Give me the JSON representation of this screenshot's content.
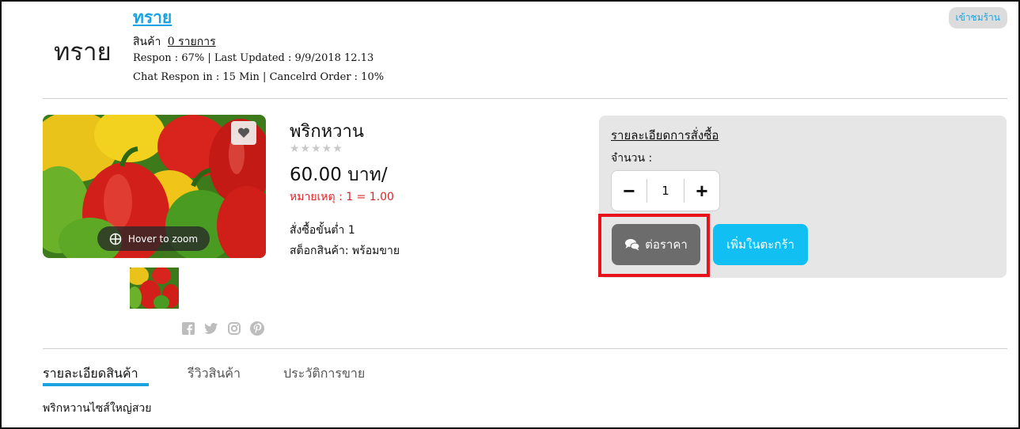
{
  "shop": {
    "logo_text": "ทราย",
    "name": "ทราย",
    "products_label": "สินค้า",
    "products_count": "0 รายการ",
    "stats_line1": "Respon : 67% | Last Updated : 9/9/2018 12.13",
    "stats_line2": "Chat Respon in : 15 Min | Cancelrd Order : 10%",
    "visit_label": "เข้าชมร้าน"
  },
  "product": {
    "title": "พริกหวาน",
    "stars": "★★★★★",
    "rating": 0,
    "price": "60.00 บาท/",
    "note": "หมายเหตุ : 1 = 1.00",
    "min_order": "สั่งซื้อขั้นต่ำ 1",
    "stock": "สต็อกสินค้า: พร้อมขาย",
    "zoom_label": "Hover to zoom",
    "image_icon": "bell-pepper-photo",
    "favorite_icon": "heart-icon"
  },
  "social_icons": [
    "facebook-icon",
    "twitter-icon",
    "instagram-icon",
    "pinterest-icon"
  ],
  "order_panel": {
    "title": "รายละเอียดการสั่งซื้อ",
    "quantity_label": "จำนวน :",
    "quantity_value": "1",
    "minus_label": "−",
    "plus_label": "+",
    "negotiate_label": "ต่อราคา",
    "add_to_cart_label": "เพิ่มในตะกร้า"
  },
  "tabs": [
    {
      "label": "รายละเอียดสินค้า",
      "active": true
    },
    {
      "label": "รีวิวสินค้า",
      "active": false
    },
    {
      "label": "ประวัติการขาย",
      "active": false
    }
  ],
  "description": "พริกหวานไซส์ใหญ่สวย",
  "colors": {
    "accent": "#1aa3e0",
    "cart_button": "#12bff2",
    "negotiate_button": "#6c6c6c",
    "note_red": "#d9262a",
    "highlight_red": "#e8121b"
  }
}
